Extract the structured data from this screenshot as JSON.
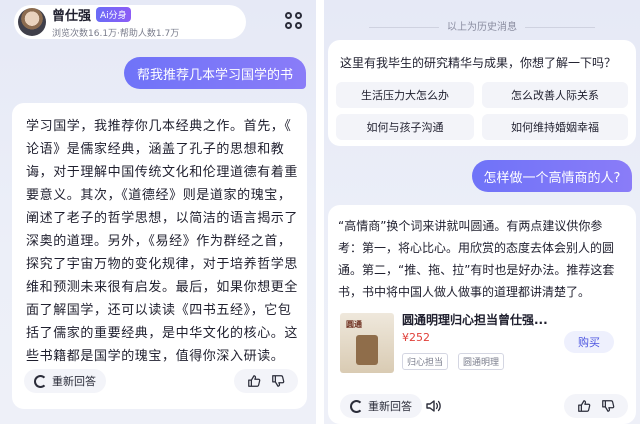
{
  "header": {
    "name": "曾仕强",
    "badge": "Ai分身",
    "stats": "浏览次数16.1万·帮助人数1.7万"
  },
  "left": {
    "user_message": "帮我推荐几本学习国学的书",
    "answer_lines": [
      "学习国学，我推荐你几本经典之作。首先，《",
      "论语》是儒家经典，涵盖了孔子的思想和教",
      "诲，对于理解中国传统文化和伦理道德有着重",
      "要意义。其次，《道德经》则是道家的瑰宝，",
      "阐述了老子的哲学思想，以简洁的语言揭示了",
      "深奥的道理。另外，《易经》作为群经之首，",
      "探究了宇宙万物的变化规律，对于培养哲学思",
      "维和预测未来很有启发。最后，如果你想更全",
      "面了解国学，还可以读读《四书五经》，它包",
      "括了儒家的重要经典，是中华文化的核心。这",
      "些书籍都是国学的瑰宝，值得你深入研读。"
    ],
    "regenerate_label": "重新回答"
  },
  "right": {
    "history_note": "以上为历史消息",
    "prompt_text": "这里有我毕生的研究精华与成果，你想了解一下吗？",
    "questions": [
      "生活压力大怎么办",
      "怎么改善人际关系",
      "如何与孩子沟通",
      "如何维持婚姻幸福"
    ],
    "user_message": "怎样做一个高情商的人?",
    "answer_lines": [
      "“高情商”换个词来讲就叫圆通。有两点建议供你参",
      "考：第一，将心比心。用欣赏的态度去体会别人的圆",
      "通。第二，“推、拖、拉”有时也是好办法。推荐这套",
      "书，书中将中国人做人做事的道理都讲清楚了。"
    ],
    "book": {
      "cover_text": "圆通",
      "title": "圆通明理归心担当曾仕强...",
      "price": "¥252",
      "tags": [
        "归心担当",
        "圆通明理"
      ],
      "buy_label": "购买"
    },
    "regenerate_label": "重新回答"
  }
}
